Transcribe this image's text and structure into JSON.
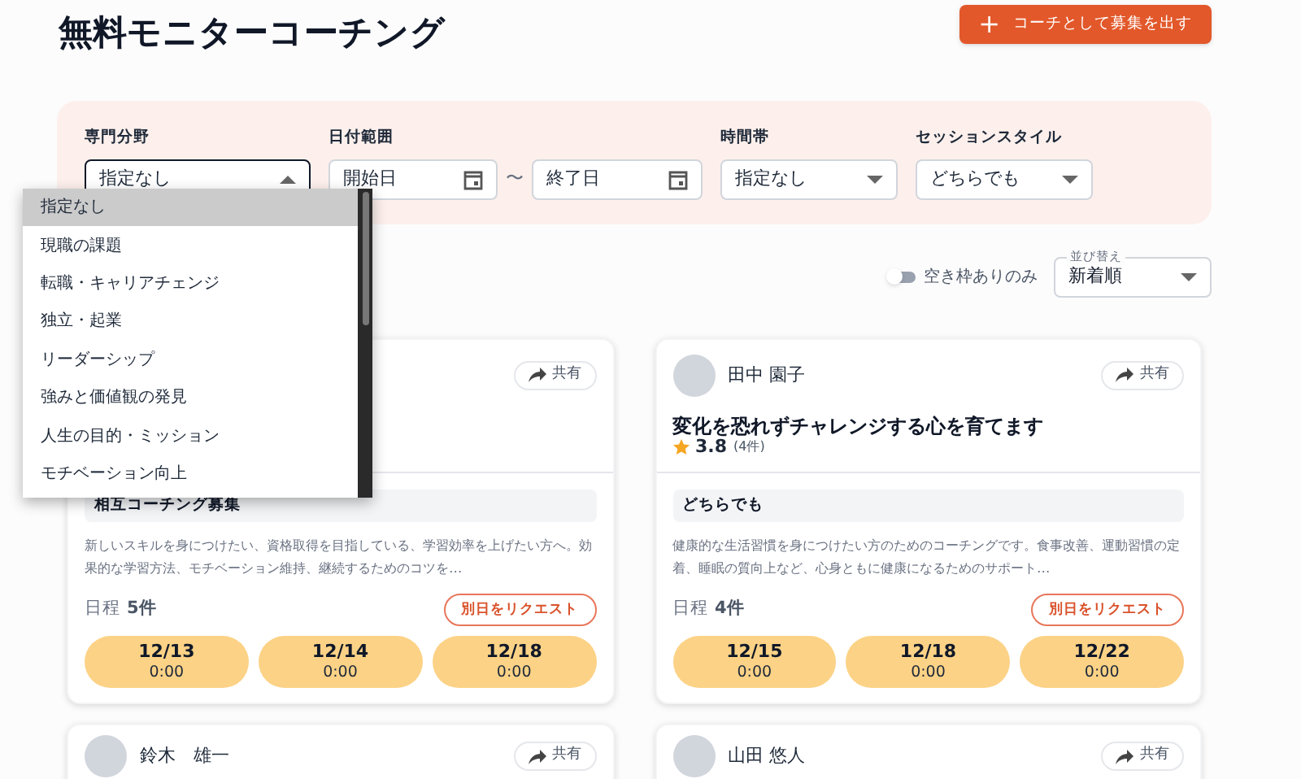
{
  "header": {
    "title": "無料モニターコーチング",
    "cta_button": {
      "icon": "+",
      "label": "コーチとして募集を出す"
    }
  },
  "filters": [
    {
      "kind": "select",
      "label": "専門分野",
      "value": "指定なし",
      "open": true
    },
    {
      "kind": "daterange",
      "label": "日付範囲",
      "start_placeholder": "開始日",
      "separator": "〜",
      "end_placeholder": "終了日"
    },
    {
      "kind": "select",
      "label": "時間帯",
      "value": "指定なし",
      "open": false
    },
    {
      "kind": "select",
      "label": "セッションスタイル",
      "value": "どちらでも",
      "open": false
    }
  ],
  "dropdown_menu": [
    {
      "label": "指定なし",
      "selected": true
    },
    {
      "label": "現職の課題",
      "selected": false
    },
    {
      "label": "転職・キャリアチェンジ",
      "selected": false
    },
    {
      "label": "独立・起業",
      "selected": false
    },
    {
      "label": "リーダーシップ",
      "selected": false
    },
    {
      "label": "強みと価値観の発見",
      "selected": false
    },
    {
      "label": "人生の目的・ミッション",
      "selected": false
    },
    {
      "label": "モチベーション向上",
      "selected": false
    }
  ],
  "toolbar": {
    "toggle": {
      "label": "空き枠ありのみ",
      "on": false
    },
    "sort": {
      "label": "並び替え",
      "value": "新着順"
    }
  },
  "cards": [
    {
      "share_label": "共有",
      "tag": "相互コーチング募集",
      "description": "新しいスキルを身につけたい、資格取得を目指している、学習効率を上げたい方へ。効果的な学習方法、モチベーション維持、継続するためのコツを…",
      "schedule_label": "日程",
      "schedule_count": "5件",
      "request_button": "別日をリクエスト",
      "slots": [
        {
          "date": "12/13",
          "time": "0:00"
        },
        {
          "date": "12/14",
          "time": "0:00"
        },
        {
          "date": "12/18",
          "time": "0:00"
        }
      ]
    },
    {
      "name": "田中 園子",
      "share_label": "共有",
      "title": "変化を恐れずチャレンジする心を育てます",
      "rating": "3.8",
      "reviews": "(4件)",
      "tag": "どちらでも",
      "description": "健康的な生活習慣を身につけたい方のためのコーチングです。食事改善、運動習慣の定着、睡眠の質向上など、心身ともに健康になるためのサポート…",
      "schedule_label": "日程",
      "schedule_count": "4件",
      "request_button": "別日をリクエスト",
      "slots": [
        {
          "date": "12/15",
          "time": "0:00"
        },
        {
          "date": "12/18",
          "time": "0:00"
        },
        {
          "date": "12/22",
          "time": "0:00"
        }
      ]
    },
    {
      "name": "鈴木　雄一",
      "share_label": "共有"
    },
    {
      "name": "山田 悠人",
      "share_label": "共有"
    }
  ]
}
